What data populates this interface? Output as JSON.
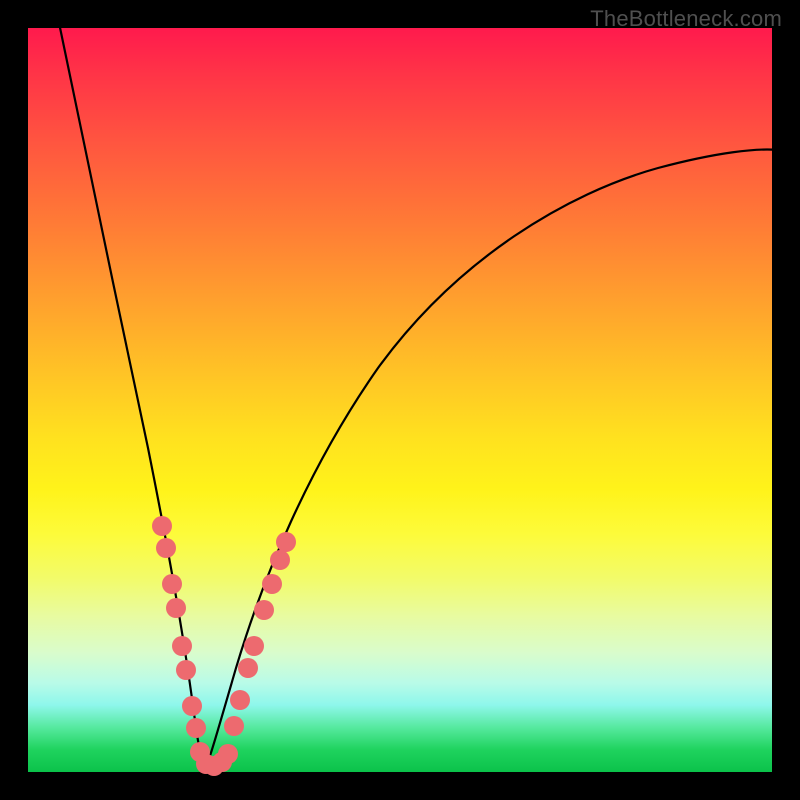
{
  "watermark": "TheBottleneck.com",
  "colors": {
    "frame": "#000000",
    "bead": "#ed6a6f",
    "curve": "#000000",
    "gradient_top": "#ff1a4d",
    "gradient_bottom": "#0bc24a"
  },
  "chart_data": {
    "type": "line",
    "title": "",
    "xlabel": "",
    "ylabel": "",
    "xlim": [
      0,
      100
    ],
    "ylim": [
      0,
      100
    ],
    "note": "Axes are unlabeled; values are approximate pixel-normalized percentages read from the plot. Two curves form a V with minimum near x≈23; pink beads cluster near the bottom of each arm.",
    "series": [
      {
        "name": "left-arm",
        "x": [
          4,
          6,
          8,
          10,
          12,
          14,
          16,
          18,
          20,
          21,
          22,
          23
        ],
        "y": [
          100,
          85,
          70,
          57,
          45,
          35,
          26,
          18,
          10,
          6,
          2,
          0
        ]
      },
      {
        "name": "right-arm",
        "x": [
          23,
          25,
          27,
          30,
          34,
          40,
          48,
          58,
          70,
          82,
          92,
          100
        ],
        "y": [
          0,
          4,
          10,
          18,
          28,
          40,
          52,
          62,
          70,
          76,
          80,
          83
        ]
      }
    ],
    "beads": {
      "description": "Pink circular markers clustered along lower portion of each curve arm and across the valley floor.",
      "left_arm_points": [
        {
          "x": 16.0,
          "y": 29
        },
        {
          "x": 16.6,
          "y": 26
        },
        {
          "x": 17.6,
          "y": 21
        },
        {
          "x": 18.2,
          "y": 18
        },
        {
          "x": 19.2,
          "y": 13
        },
        {
          "x": 19.8,
          "y": 10
        },
        {
          "x": 20.6,
          "y": 6
        },
        {
          "x": 21.2,
          "y": 4
        }
      ],
      "right_arm_points": [
        {
          "x": 26.0,
          "y": 8
        },
        {
          "x": 26.8,
          "y": 11
        },
        {
          "x": 27.8,
          "y": 15
        },
        {
          "x": 28.4,
          "y": 17
        },
        {
          "x": 29.6,
          "y": 21
        },
        {
          "x": 30.6,
          "y": 24
        },
        {
          "x": 31.6,
          "y": 27
        },
        {
          "x": 32.2,
          "y": 29
        }
      ],
      "floor_points": [
        {
          "x": 21.8,
          "y": 1.2
        },
        {
          "x": 22.6,
          "y": 0.6
        },
        {
          "x": 23.4,
          "y": 0.5
        },
        {
          "x": 24.2,
          "y": 0.8
        },
        {
          "x": 25.0,
          "y": 1.4
        }
      ]
    }
  }
}
